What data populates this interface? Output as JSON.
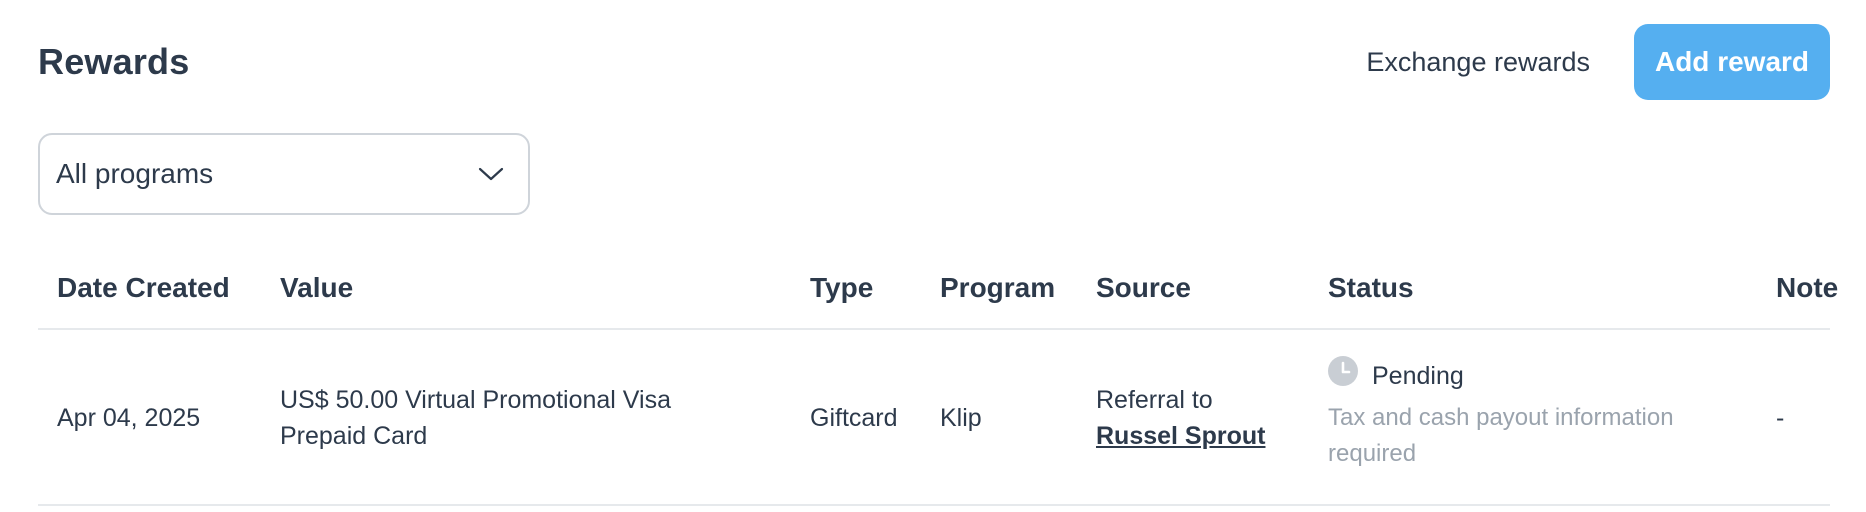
{
  "header": {
    "title": "Rewards",
    "exchange_label": "Exchange rewards",
    "add_label": "Add reward"
  },
  "filter": {
    "selected": "All programs"
  },
  "table": {
    "columns": [
      "Date Created",
      "Value",
      "Type",
      "Program",
      "Source",
      "Status",
      "Note"
    ],
    "rows": [
      {
        "date": "Apr 04, 2025",
        "value_line1": "US$ 50.00 Virtual Promotional Visa",
        "value_line2": "Prepaid Card",
        "type": "Giftcard",
        "program": "Klip",
        "source_prefix": "Referral to",
        "source_name": "Russel Sprout",
        "status": "Pending",
        "status_icon": "clock-icon",
        "status_detail_line1": "Tax and cash payout information",
        "status_detail_line2": "required",
        "note": "-"
      }
    ]
  },
  "colors": {
    "primary": "#55aff0",
    "text": "#2d3a4b",
    "muted": "#9aa3ad",
    "border": "#e6e9ec",
    "icon_muted": "#c9ced4"
  }
}
